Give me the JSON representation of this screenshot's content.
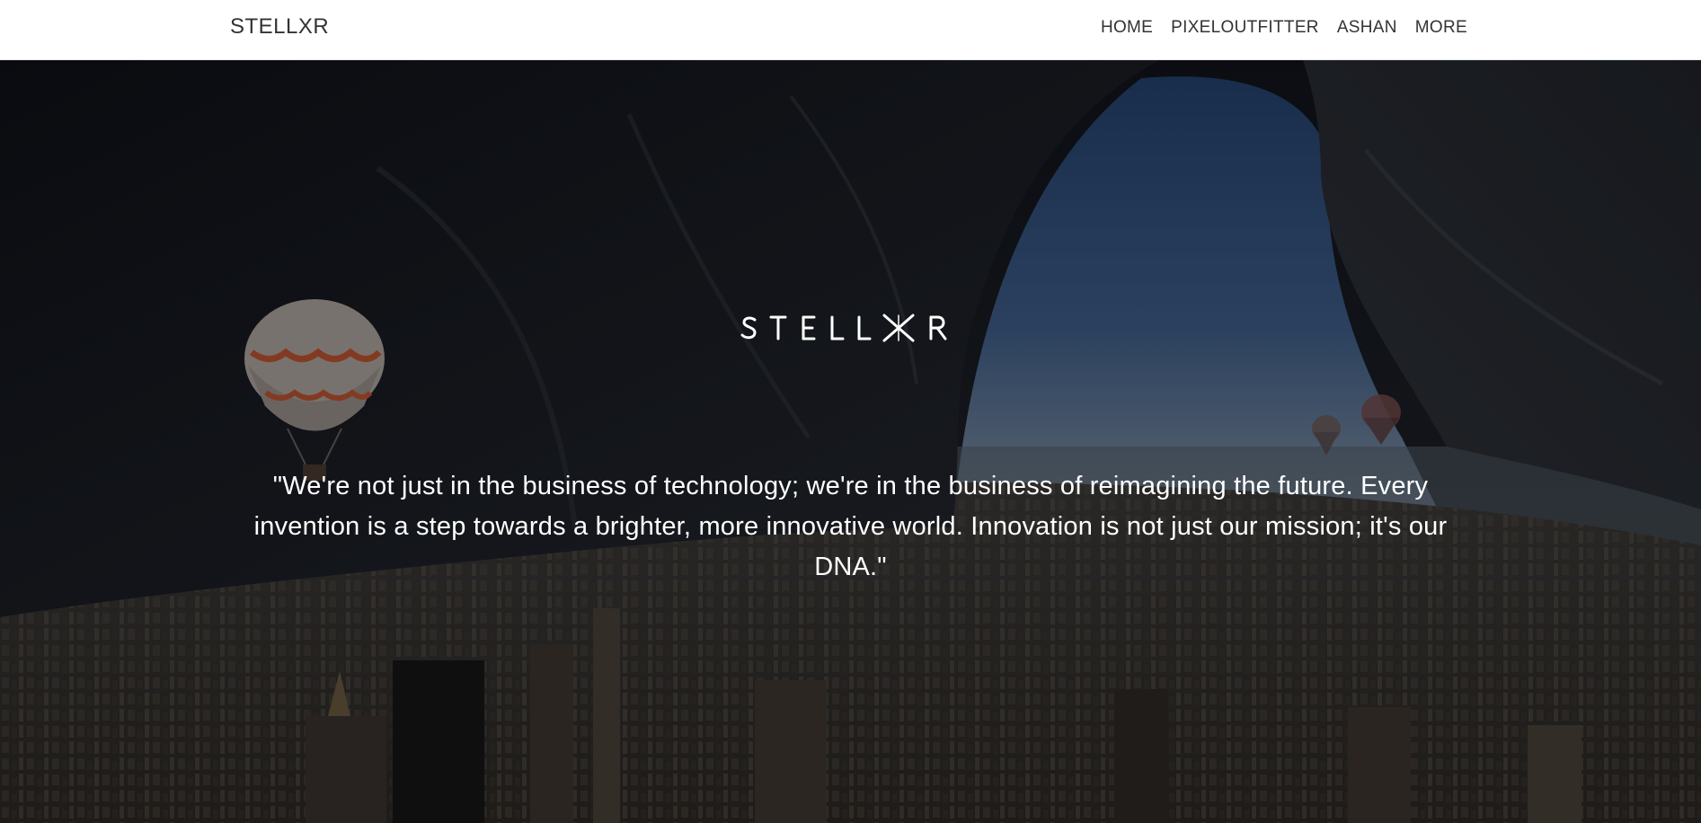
{
  "navbar": {
    "brand": "STELLXR",
    "links": [
      "HOME",
      "PIXELOUTFITTER",
      "ASHAN",
      "MORE"
    ]
  },
  "hero": {
    "background": "cave-city-balloons-image",
    "logo_text": "STELLXR",
    "quote": "\"We're not just in the business of technology; we're in the business of reimagining the future. Every invention is a step towards a brighter, more innovative world. Innovation is not just our mission; it's our DNA.\""
  },
  "colors": {
    "navbar_bg": "#ffffff",
    "nav_text": "#333333",
    "hero_text": "#ffffff",
    "sky": "#3d5d88"
  }
}
